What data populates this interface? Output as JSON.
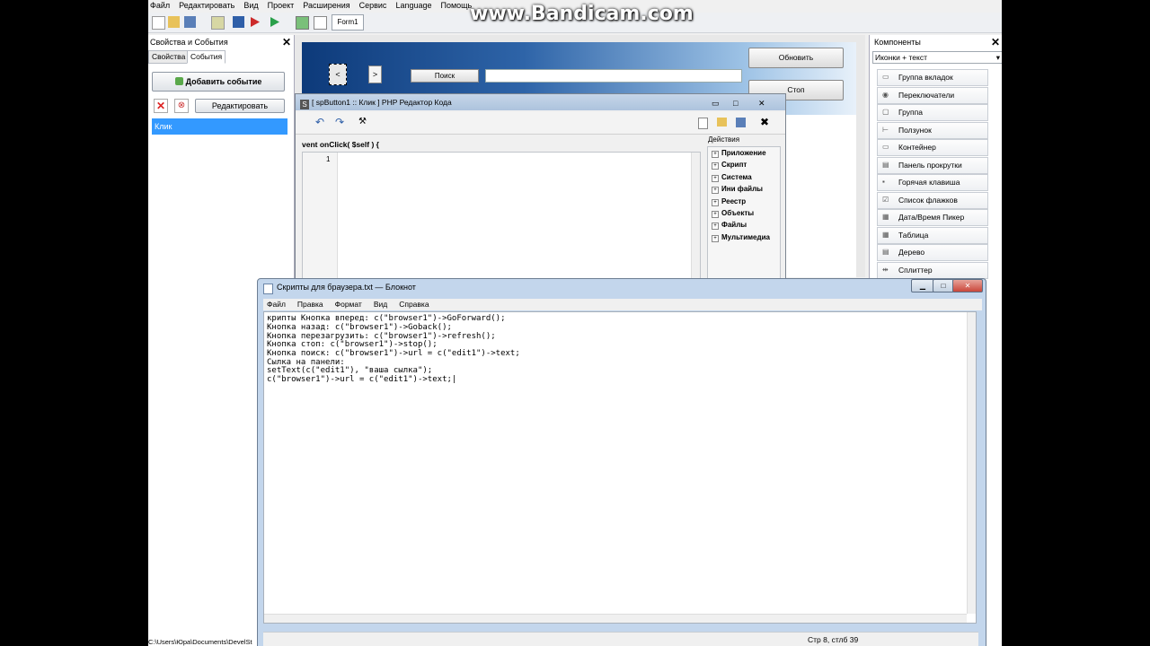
{
  "watermark": "www.Bandicam.com",
  "menubar": [
    "Файл",
    "Редактировать",
    "Вид",
    "Проект",
    "Расширения",
    "Сервис",
    "Language",
    "Помощь"
  ],
  "toolbar": {
    "form_tab": "Form1"
  },
  "left_panel": {
    "title": "Свойства и События",
    "tabs": [
      "Свойства",
      "События"
    ],
    "add_event_button": "Добавить событие",
    "edit_button": "Редактировать",
    "events": [
      "Клик"
    ]
  },
  "form_preview": {
    "back_button": "<",
    "forward_button": ">",
    "search_button": "Поиск",
    "refresh_button": "Обновить",
    "stop_button": "Стоп"
  },
  "code_editor": {
    "title": "[ spButton1 :: Клик ] PHP Редактор Кода",
    "signature": "vent onClick( $self ) {",
    "line_number": "1",
    "actions_title": "Действия",
    "actions": [
      "Приложение",
      "Скрипт",
      "Система",
      "Ини файлы",
      "Реестр",
      "Объекты",
      "Файлы",
      "Мультимедиа"
    ]
  },
  "components": {
    "title": "Компоненты",
    "category": "Иконки + текст",
    "items": [
      {
        "label": "Группа вкладок",
        "icon": "tabs-icon"
      },
      {
        "label": "Переключатели",
        "icon": "radio-icon"
      },
      {
        "label": "Группа",
        "icon": "group-icon"
      },
      {
        "label": "Ползунок",
        "icon": "slider-icon"
      },
      {
        "label": "Контейнер",
        "icon": "container-icon"
      },
      {
        "label": "Панель прокрутки",
        "icon": "scrollpanel-icon"
      },
      {
        "label": "Горячая клавиша",
        "icon": "hotkey-icon"
      },
      {
        "label": "Список флажков",
        "icon": "checklist-icon"
      },
      {
        "label": "Дата/Время Пикер",
        "icon": "calendar-icon"
      },
      {
        "label": "Таблица",
        "icon": "table-icon"
      },
      {
        "label": "Дерево",
        "icon": "tree-icon"
      },
      {
        "label": "Сплиттер",
        "icon": "splitter-icon"
      }
    ]
  },
  "notepad": {
    "title": "Скрипты для браузера.txt — Блокнот",
    "menu": [
      "Файл",
      "Правка",
      "Формат",
      "Вид",
      "Справка"
    ],
    "lines": [
      "крипты Кнопка вперед: c(\"browser1\")->GoForward();",
      "Кнопка назад: c(\"browser1\")->Goback();",
      "Кнопка перезагрузить: c(\"browser1\")->refresh();",
      "Кнопка стоп: c(\"browser1\")->stop();",
      "Кнопка поиск: c(\"browser1\")->url = c(\"edit1\")->text;",
      "Сылка на панели:",
      "setText(c(\"edit1\"), \"ваша сылка\");",
      "c(\"browser1\")->url = c(\"edit1\")->text;|"
    ],
    "status": "Стр 8, стлб 39"
  },
  "path": "C:\\Users\\Юра\\Documents\\DevelSt"
}
